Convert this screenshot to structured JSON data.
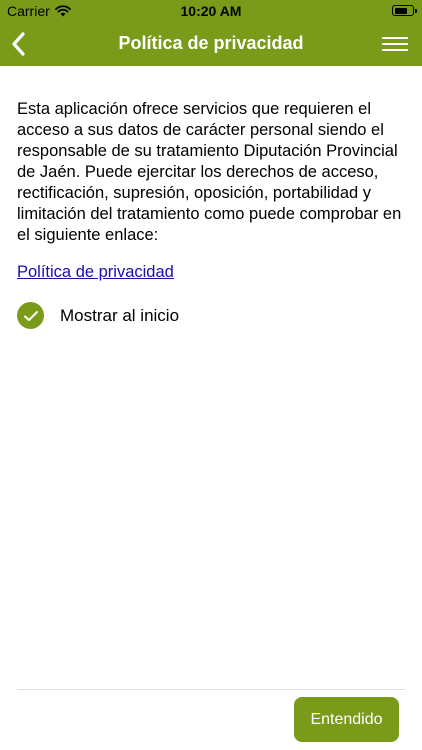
{
  "status_bar": {
    "carrier": "Carrier",
    "time": "10:20 AM",
    "battery_level": 0.8
  },
  "nav": {
    "title": "Política de privacidad",
    "back_icon": "chevron-left-icon",
    "menu_icon": "hamburger-menu-icon"
  },
  "content": {
    "intro": "Esta aplicación ofrece servicios que requieren el acceso a sus datos de carácter personal siendo el responsable de su tratamiento Diputación Provincial de Jaén. Puede ejercitar los derechos de acceso, rectificación, supresión, oposición, portabilidad y limitación del tratamiento como puede comprobar en el siguiente enlace:",
    "link_label": "Política de privacidad",
    "show_at_start_label": "Mostrar al inicio",
    "show_at_start_checked": true
  },
  "footer": {
    "ok_label": "Entendido"
  },
  "colors": {
    "accent": "#7a9a1a",
    "link": "#1a0dab"
  }
}
